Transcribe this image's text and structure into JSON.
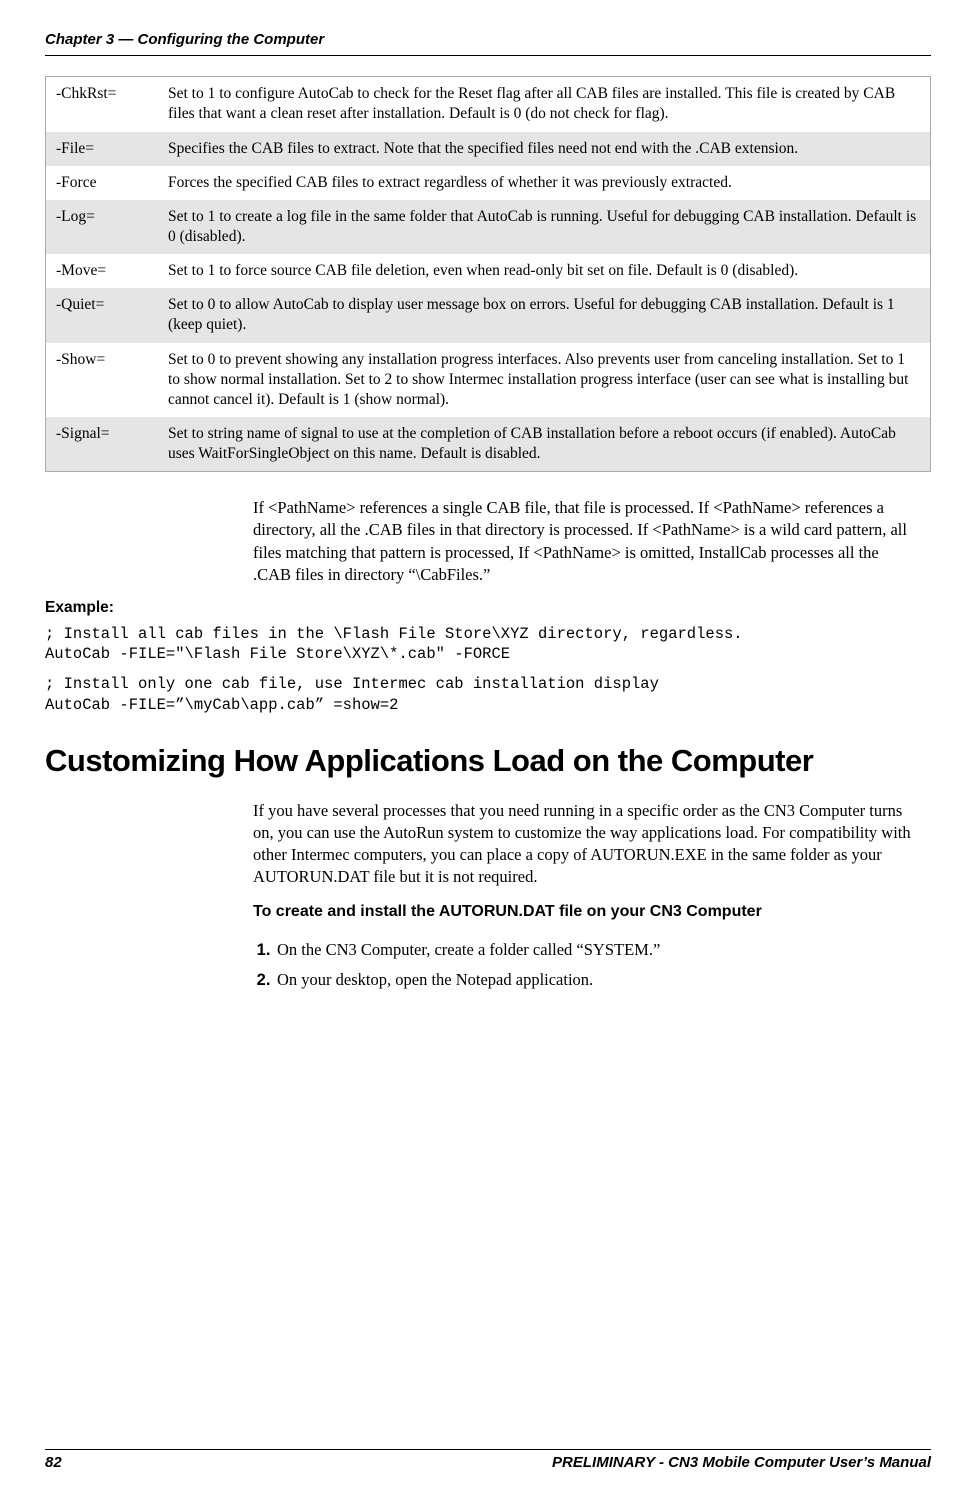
{
  "header": {
    "chapter": "Chapter 3 — Configuring the Computer"
  },
  "table": {
    "rows": [
      {
        "key": "-ChkRst=",
        "desc": "Set to 1 to configure AutoCab to check for the Reset flag after all CAB files are installed. This file is created by CAB files that want a clean reset after installation. Default is 0 (do not check for flag)."
      },
      {
        "key": "-File=",
        "desc": "Specifies the CAB files to extract. Note that the specified files need not end with the .CAB extension."
      },
      {
        "key": "-Force",
        "desc": "Forces the specified CAB files to extract regardless of whether it was previously extracted."
      },
      {
        "key": "-Log=",
        "desc": "Set to 1 to create a log file in the same folder that AutoCab is running. Useful for debugging CAB installation. Default is 0 (disabled)."
      },
      {
        "key": "-Move=",
        "desc": "Set to 1 to force source CAB file deletion, even when read-only bit set on file. Default is 0 (disabled)."
      },
      {
        "key": "-Quiet=",
        "desc": "Set to 0 to allow AutoCab to display user message box on errors. Useful for debugging CAB installation. Default is 1 (keep quiet)."
      },
      {
        "key": "-Show=",
        "desc": "Set to 0 to prevent showing any installation progress interfaces. Also prevents user from canceling installation. Set to 1 to show normal installation. Set to 2 to show Intermec installation progress interface (user can see what is installing but cannot cancel it). Default is 1 (show normal)."
      },
      {
        "key": "-Signal=",
        "desc": "Set to string name of signal to use at the completion of CAB installation before a reboot occurs (if enabled). AutoCab uses WaitForSingleObject on this name. Default is disabled."
      }
    ]
  },
  "body": {
    "para1": "If <PathName> references a single CAB file, that file is processed. If <PathName> references a directory, all the .CAB files in that directory is processed. If <PathName> is a wild card pattern, all files matching that pattern is processed, If <PathName> is omitted, InstallCab processes all the .CAB files in directory “\\CabFiles.”"
  },
  "example": {
    "label": "Example:",
    "code1": "; Install all cab files in the \\Flash File Store\\XYZ directory, regardless.\nAutoCab -FILE=\"\\Flash File Store\\XYZ\\*.cab\" -FORCE",
    "code2": "; Install only one cab file, use Intermec cab installation display\nAutoCab -FILE=”\\myCab\\app.cab” =show=2"
  },
  "section": {
    "title": "Customizing How Applications Load on the Computer",
    "para": "If you have several processes that you need running in a specific order as the CN3 Computer turns on, you can use the AutoRun system to customize the way applications load. For compatibility with other Intermec computers, you can place a copy of AUTORUN.EXE in the same folder as your AUTORUN.DAT file but it is not required.",
    "subhead": "To create and install the AUTORUN.DAT file on your CN3 Computer",
    "steps": [
      "On the CN3 Computer, create a folder called “SYSTEM.”",
      "On your desktop, open the Notepad application."
    ]
  },
  "footer": {
    "page": "82",
    "doc": "PRELIMINARY - CN3 Mobile Computer User’s Manual"
  }
}
